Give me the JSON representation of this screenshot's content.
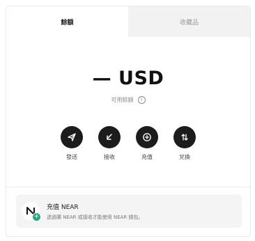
{
  "tabs": [
    {
      "label": "餘額",
      "active": true
    },
    {
      "label": "收藏品",
      "active": false
    }
  ],
  "balance": {
    "amount": "— USD",
    "available_label": "可用餘額"
  },
  "actions": [
    {
      "label": "發送",
      "icon": "send-icon"
    },
    {
      "label": "接收",
      "icon": "receive-icon"
    },
    {
      "label": "充值",
      "icon": "top-up-icon"
    },
    {
      "label": "兌換",
      "icon": "swap-icon"
    }
  ],
  "banner": {
    "title": "充值 NEAR",
    "description": "透過購 NEAR 或接收才能使用 NEAR 錢包。",
    "logo": "near-logo-icon"
  },
  "colors": {
    "accent_dark": "#1c1c1c",
    "badge_green": "#2fa37b",
    "inactive_tab_bg": "#f2f2f2"
  }
}
